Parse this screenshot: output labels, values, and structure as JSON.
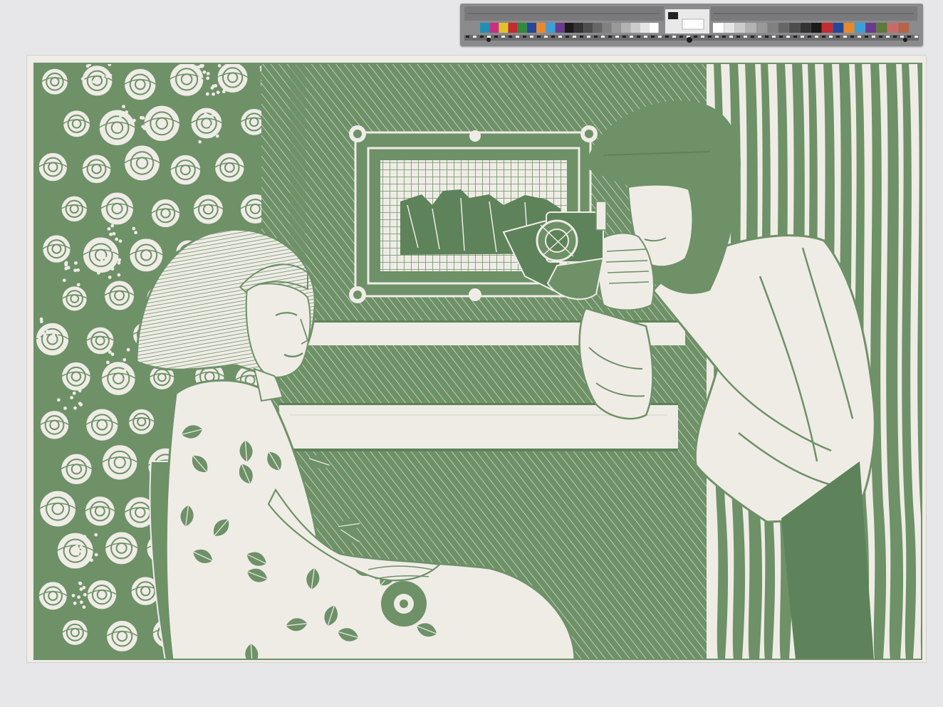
{
  "artwork": {
    "palette": {
      "ink": "#6e9168",
      "ink_dark": "#5e8259",
      "paper": "#efece6",
      "backdrop": "#e7e7e9"
    },
    "scene_elements": [
      "floral-wallpaper",
      "hatched-wall",
      "framed-painting",
      "seated-girl",
      "photographer",
      "camera",
      "striped-curtain"
    ]
  },
  "color_target": {
    "patches_left": [
      "#1f8fb5",
      "#c7317d",
      "#e0c32a",
      "#c52a2f",
      "#2d8a3e",
      "#25479a",
      "#e88a2a",
      "#3c9fd7",
      "#6a3a8c",
      "#1a1a1a",
      "#333333",
      "#4d4d4d",
      "#666666",
      "#808080",
      "#999999",
      "#b3b3b3",
      "#cccccc",
      "#e6e6e6",
      "#ffffff"
    ],
    "patches_right": [
      "#ffffff",
      "#e6e6e6",
      "#cccccc",
      "#b3b3b3",
      "#999999",
      "#808080",
      "#666666",
      "#4d4d4d",
      "#333333",
      "#1a1a1a",
      "#c52a2f",
      "#25479a",
      "#e88a2a",
      "#3c9fd7",
      "#6a3a8c",
      "#5c7a3a",
      "#c56b6b",
      "#b5644b"
    ]
  }
}
